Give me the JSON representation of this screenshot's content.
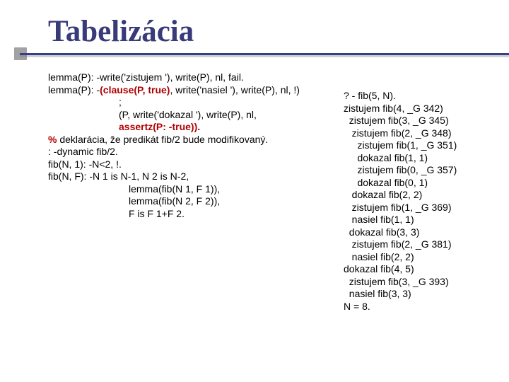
{
  "title": "Tabelizácia",
  "left": {
    "l1": "lemma(P): -write('zistujem '), write(P), nl, fail.",
    "l2a": "lemma(P): -",
    "l2b": "(clause(P, true)",
    "l2c": ", write('nasiel '), write(P), nl, !)",
    "l3": ";",
    "l4": "(P, write('dokazal '), write(P), nl,",
    "l5": " assertz(P: -true)).",
    "spacer1": " ",
    "l6a": "%",
    "l6b": " deklarácia, že predikát fib/2 bude modifikovaný.",
    "l7": ": -dynamic fib/2.",
    "spacer2": " ",
    "l8": "fib(N, 1): -N<2, !.",
    "l9": "fib(N, F): -N 1 is N-1, N 2 is N-2,",
    "l10": "lemma(fib(N 1, F 1)),",
    "l11": "lemma(fib(N 2, F 2)),",
    "l12": "F is F 1+F 2."
  },
  "right": "? - fib(5, N).\nzistujem fib(4, _G 342)\n  zistujem fib(3, _G 345)\n   zistujem fib(2, _G 348)\n     zistujem fib(1, _G 351)\n     dokazal fib(1, 1)\n     zistujem fib(0, _G 357)\n     dokazal fib(0, 1)\n   dokazal fib(2, 2)\n   zistujem fib(1, _G 369)\n   nasiel fib(1, 1)\n  dokazal fib(3, 3)\n   zistujem fib(2, _G 381)\n   nasiel fib(2, 2)\ndokazal fib(4, 5)\n  zistujem fib(3, _G 393)\n  nasiel fib(3, 3)\nN = 8."
}
